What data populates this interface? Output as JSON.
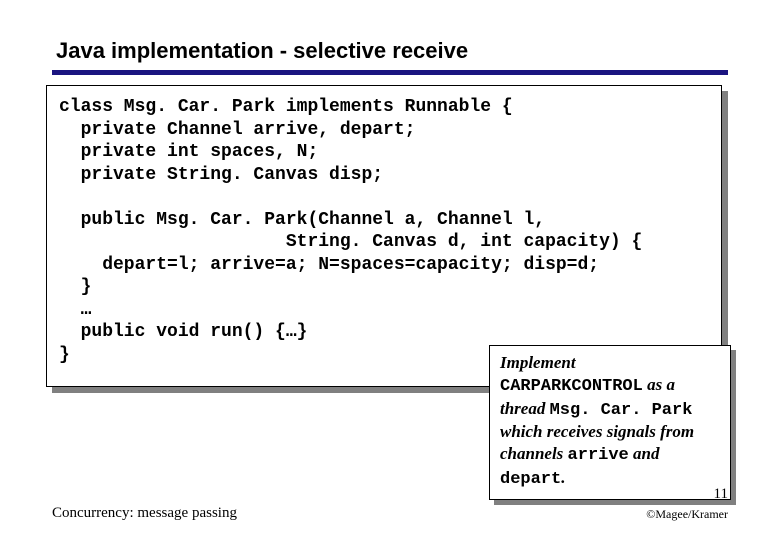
{
  "title": "Java implementation - selective receive",
  "code": {
    "l1": "class Msg. Car. Park implements Runnable {",
    "l2": "  private Channel arrive, depart;",
    "l3": "  private int spaces, N;",
    "l4": "  private String. Canvas disp;",
    "l5": "",
    "l6": "  public Msg. Car. Park(Channel a, Channel l,",
    "l7": "                     String. Canvas d, int capacity) {",
    "l8": "    depart=l; arrive=a; N=spaces=capacity; disp=d;",
    "l9": "  }",
    "l10": "  …",
    "l11": "  public void run() {…}",
    "l12": "}"
  },
  "annot": {
    "w1": "Implement",
    "w2": "CARPARKCONTROL",
    "w3": "as a thread",
    "w4": "Msg. Car. Park",
    "w5": "which receives signals from channels",
    "w6": "arrive",
    "w7": "and",
    "w8": "depart"
  },
  "footer": {
    "left": "Concurrency: message passing",
    "page": "11",
    "copyright": "©Magee/Kramer"
  }
}
